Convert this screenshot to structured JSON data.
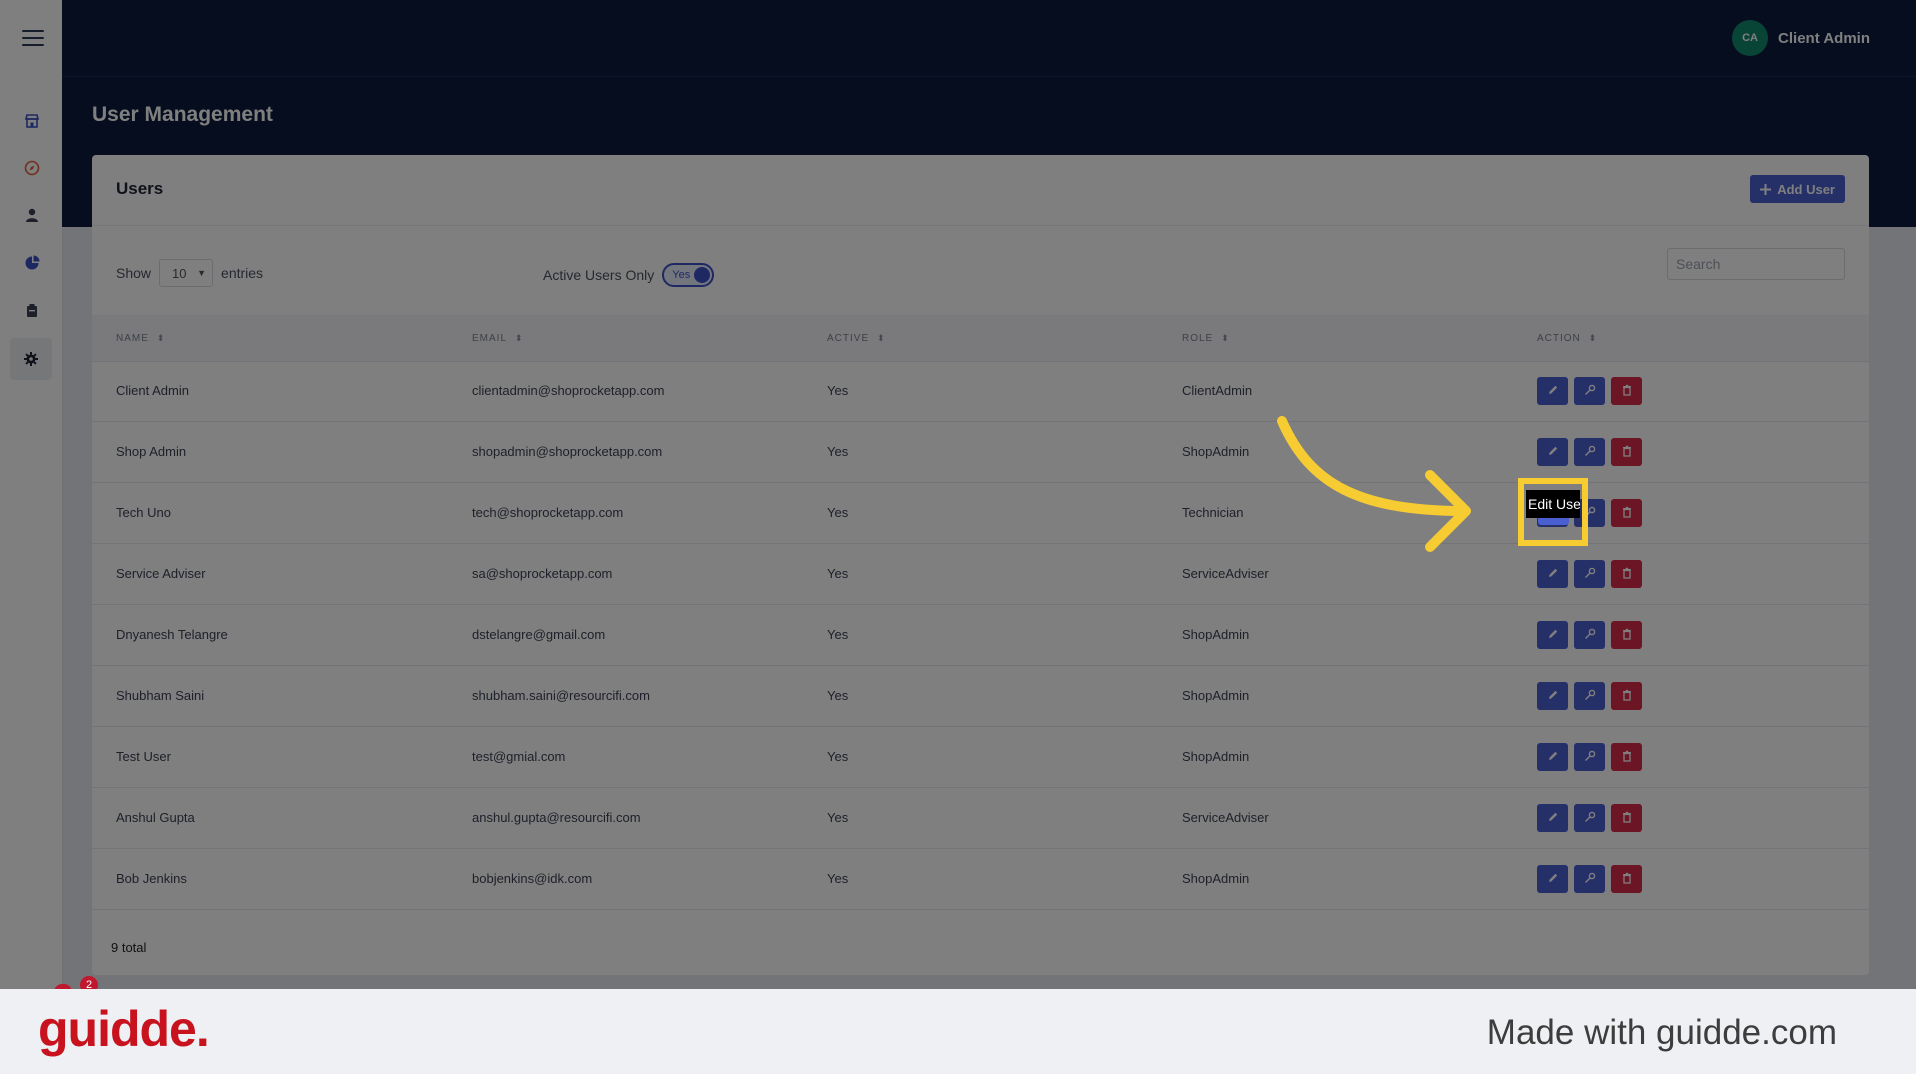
{
  "header": {
    "user_initials": "CA",
    "user_name": "Client Admin",
    "page_title": "User Management"
  },
  "sidebar": {
    "items": [
      "store-icon",
      "compass-icon",
      "user-icon",
      "chart-pie-icon",
      "inventory-icon",
      "settings-icon"
    ],
    "active": "settings-icon"
  },
  "card": {
    "title": "Users",
    "add_button": "Add User"
  },
  "controls": {
    "show_label": "Show",
    "entries_value": "10",
    "entries_label": "entries",
    "active_only_label": "Active Users Only",
    "toggle_label": "Yes",
    "search_placeholder": "Search"
  },
  "table": {
    "columns": [
      "NAME",
      "EMAIL",
      "ACTIVE",
      "ROLE",
      "ACTION"
    ],
    "rows": [
      {
        "name": "Client Admin",
        "email": "clientadmin@shoprocketapp.com",
        "active": "Yes",
        "role": "ClientAdmin"
      },
      {
        "name": "Shop Admin",
        "email": "shopadmin@shoprocketapp.com",
        "active": "Yes",
        "role": "ShopAdmin"
      },
      {
        "name": "Tech Uno",
        "email": "tech@shoprocketapp.com",
        "active": "Yes",
        "role": "Technician"
      },
      {
        "name": "Service Adviser",
        "email": "sa@shoprocketapp.com",
        "active": "Yes",
        "role": "ServiceAdviser"
      },
      {
        "name": "Dnyanesh Telangre",
        "email": "dstelangre@gmail.com",
        "active": "Yes",
        "role": "ShopAdmin"
      },
      {
        "name": "Shubham Saini",
        "email": "shubham.saini@resourcifi.com",
        "active": "Yes",
        "role": "ShopAdmin"
      },
      {
        "name": "Test User",
        "email": "test@gmial.com",
        "active": "Yes",
        "role": "ShopAdmin"
      },
      {
        "name": "Anshul Gupta",
        "email": "anshul.gupta@resourcifi.com",
        "active": "Yes",
        "role": "ServiceAdviser"
      },
      {
        "name": "Bob Jenkins",
        "email": "bobjenkins@idk.com",
        "active": "Yes",
        "role": "ShopAdmin"
      }
    ],
    "total": "9 total"
  },
  "tooltip": {
    "text": "Edit User"
  },
  "notification": {
    "count": "2"
  },
  "footer": {
    "brand": "guidde.",
    "made_with": "Made with guidde.com"
  },
  "colors": {
    "navy": "#0d1b3e",
    "primary": "#4a5fd1",
    "danger": "#d72b4a",
    "highlight": "#f7cc33",
    "brand": "#c8131f"
  }
}
